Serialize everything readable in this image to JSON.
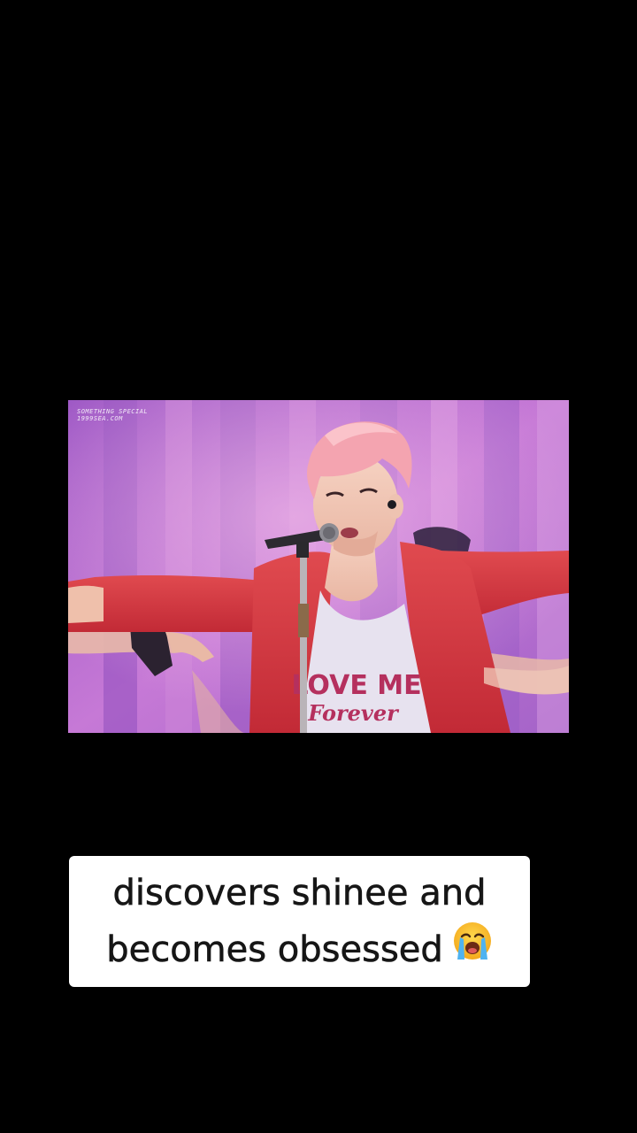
{
  "photo": {
    "watermark_line1": "SOMETHING SPECIAL",
    "watermark_line2": "1999SEA.COM",
    "shirt_text_line1": "LOVE ME",
    "shirt_text_line2": "Forever",
    "background_color": "#b46fd0",
    "jacket_color": "#d8333f",
    "hair_color": "#f6a7b2"
  },
  "caption": {
    "line1": "discovers shinee and",
    "line2": "becomes obsessed",
    "emoji": "crying-face-emoji"
  }
}
